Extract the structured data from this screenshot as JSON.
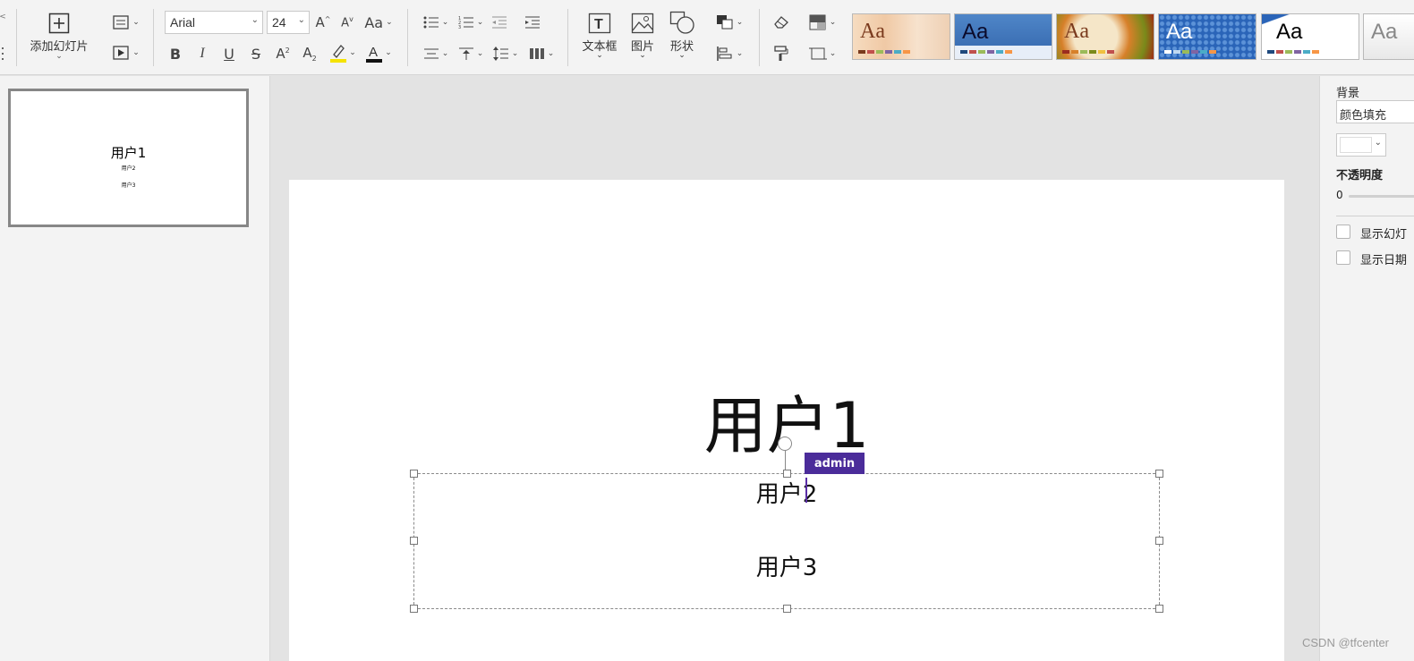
{
  "toolbar": {
    "add_slide_label": "添加幻灯片",
    "font_family": "Arial",
    "font_size": "24",
    "textbox_label": "文本框",
    "picture_label": "图片",
    "shape_label": "形状",
    "themes": [
      {
        "name": "theme-1",
        "aa": "Aa"
      },
      {
        "name": "theme-2",
        "aa": "Aa"
      },
      {
        "name": "theme-3",
        "aa": "Aa"
      },
      {
        "name": "theme-4",
        "aa": "Aa"
      },
      {
        "name": "theme-5",
        "aa": "Aa"
      },
      {
        "name": "theme-6",
        "aa": "Aa"
      }
    ]
  },
  "thumbnail": {
    "title": "用户1",
    "line2": "用户2",
    "line3": "用户3"
  },
  "slide": {
    "title": "用户1",
    "line2": "用户2",
    "line3": "用户3",
    "collab_user": "admin"
  },
  "right_panel": {
    "background_label": "背景",
    "fill_type": "颜色填充",
    "opacity_label": "不透明度",
    "opacity_value": "0",
    "show_slide_number": "显示幻灯",
    "show_date": "显示日期"
  },
  "watermark": "CSDN @tfcenter",
  "colors": {
    "accent": "#4b2c9a",
    "toolbar_bg": "#f3f3f3",
    "canvas_bg": "#e3e3e3"
  }
}
